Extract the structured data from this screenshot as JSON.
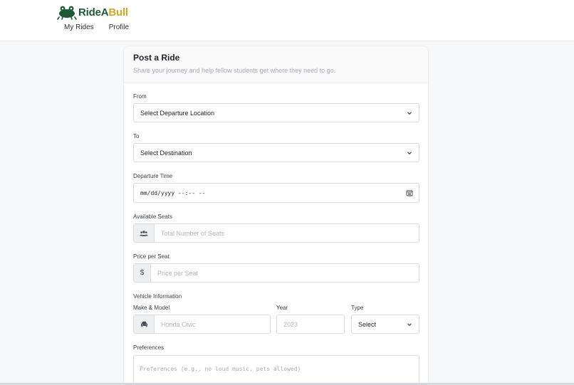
{
  "brand": {
    "name_part1": "RideA",
    "name_part2": "Bull"
  },
  "nav": [
    {
      "label": "My Rides"
    },
    {
      "label": "Profile"
    }
  ],
  "form": {
    "title": "Post a Ride",
    "subtitle": "Share your journey and help fellow students get where they need to go.",
    "from": {
      "label": "From",
      "value": "Select Departure Location"
    },
    "to": {
      "label": "To",
      "value": "Select Destination"
    },
    "departure": {
      "label": "Departure Time",
      "value": "mm/dd/yyyy --:-- --"
    },
    "seats": {
      "label": "Available Seats",
      "placeholder": "Total Number of Seats"
    },
    "price": {
      "label": "Price per Seat",
      "prefix": "$",
      "placeholder": "Price per Seat"
    },
    "vehicle": {
      "section_label": "Vehicle Information",
      "make_label": "Make & Model",
      "make_placeholder": "Honda Civic",
      "year_label": "Year",
      "year_placeholder": "2023",
      "type_label": "Type",
      "type_value": "Select"
    },
    "preferences": {
      "label": "Preferences",
      "placeholder": "Preferences (e.g., no loud music, pets allowed)"
    }
  },
  "colors": {
    "brand_green": "#1c5a32",
    "brand_gold": "#d9a521"
  },
  "icons": [
    "frog-logo-icon",
    "chevron-down-icon",
    "calendar-icon",
    "users-icon",
    "car-icon"
  ]
}
